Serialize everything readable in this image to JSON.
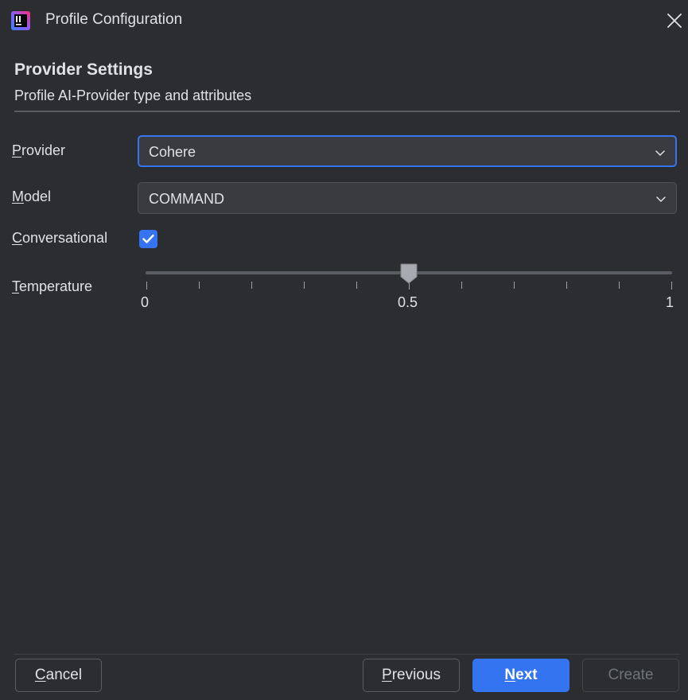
{
  "window": {
    "title": "Profile Configuration",
    "app_icon": "intellij-app-icon",
    "close_icon": "close-icon"
  },
  "section": {
    "title": "Provider Settings",
    "subtitle": "Profile AI-Provider type and attributes"
  },
  "fields": {
    "provider": {
      "label_mnemonic": "P",
      "label_rest": "rovider",
      "value": "Cohere",
      "focused": true
    },
    "model": {
      "label_mnemonic": "M",
      "label_rest": "odel",
      "value": "COMMAND"
    },
    "conversational": {
      "label_mnemonic": "C",
      "label_rest": "onversational",
      "checked": true
    },
    "temperature": {
      "label_mnemonic": "T",
      "label_rest": "emperature",
      "value": 0.5,
      "min": 0,
      "max": 1,
      "tick_labels": [
        "0",
        "0.5",
        "1"
      ]
    }
  },
  "buttons": {
    "cancel": {
      "mnemonic": "C",
      "rest": "ancel"
    },
    "previous": {
      "mnemonic": "P",
      "rest": "revious"
    },
    "next": {
      "mnemonic": "N",
      "rest": "ext"
    },
    "create": {
      "label": "Create",
      "enabled": false
    }
  },
  "colors": {
    "background": "#2b2d30",
    "accent": "#3574f0",
    "field_bg": "#393b40",
    "text": "#dfe1e5",
    "disabled_text": "#6f737a"
  }
}
